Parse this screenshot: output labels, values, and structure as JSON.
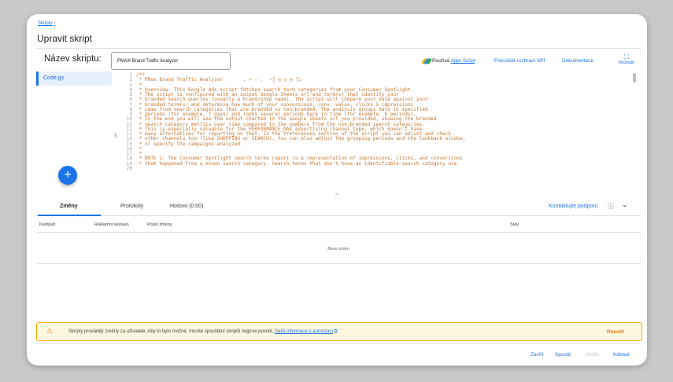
{
  "breadcrumb": {
    "label": "Skripty",
    "chevron": "›"
  },
  "page_title": "Upravit skript",
  "script_name": {
    "label": "Název skriptu:",
    "value": "PMAX Brand Traffic Analyzer"
  },
  "apps_script": {
    "text": "Používá",
    "link": "Apps Script",
    "icon": "apps-script-logo"
  },
  "top_links": {
    "advanced_api": "Pokročilá rozhraní API",
    "docs": "Dokumentace",
    "expand": "Rozbalit"
  },
  "files": [
    {
      "label": "Code.gs"
    }
  ],
  "fab_label": "+",
  "code": {
    "line_numbers": "1\n2\n3\n4\n5\n6\n7\n8\n9\n10\n11\n12\n13\n14\n15\n16\n17\n18\n19\n20",
    "lines": "/**\n * PMax Brand Traffic Analyzer       . + - . ⠀⇨[ ◎ ▢ ◎ ]⊃\n *\n * Overview: This Google Ads script fetches search term categories from your Consumer Spotlight.\n * The script is configured with an output Google Sheets url and term(s) that identify your\n * branded search queries (usually a brand/shop name). The script will compare your data against your\n * branded term(s) and determine how much of your conversions, conv. value, clicks & impressions\n * came from search categories that are branded vs non-branded. The analysis groups data in specified\n * periods (for example, 7 days) and looks several periods back in time (for example, 6 periods).\n * In the end you will see the output charted in the Google Sheets url you provided, showing the branded\n * search category metrics over time compared to the numbers from the non-branded search categories.\n * This is especially valuable for the PERFORMANCE_MAX advertising channel type, which doesn't have\n * many alternatives for reporting on that. In the Preferences section of the script you can adjust and check\n * other channels too (like SHOPPING or SEARCH). You can also adjust the grouping periods and the lookback window,\n * or specify the campaigns analyzed.\n *\n *\n * NOTE 1: The Consumer Spotlight search terms report is a representation of impressions, clicks, and conversions\n * that happened from a known search category. Search terms that don't have an identifiable search category are"
  },
  "tabs": [
    {
      "label": "Změny"
    },
    {
      "label": "Protokoly"
    },
    {
      "label": "Hotovo (0:00)"
    }
  ],
  "support_link": "Kontaktujte podporu",
  "help_icon": "help-circle-icon",
  "table": {
    "columns": [
      "Kampaň",
      "Reklamní sestava",
      "Popis změny",
      "Stav"
    ],
    "empty": "Beze změn"
  },
  "warning": {
    "text": "Skripty provádějí změny za uživatele. Aby to bylo možné, musíte spouštění skriptů nejprve povolit.",
    "link": "Další informace o autorizaci",
    "link_icon": "⧉",
    "action": "Povolit",
    "icon": "warning-triangle-icon"
  },
  "footer": {
    "close": "Zavřít",
    "run": "Spustit",
    "save": "Uložit",
    "preview": "Náhled"
  },
  "colors": {
    "accent": "#1a73e8",
    "warning": "#f9ab00",
    "code": "#c5752f"
  }
}
